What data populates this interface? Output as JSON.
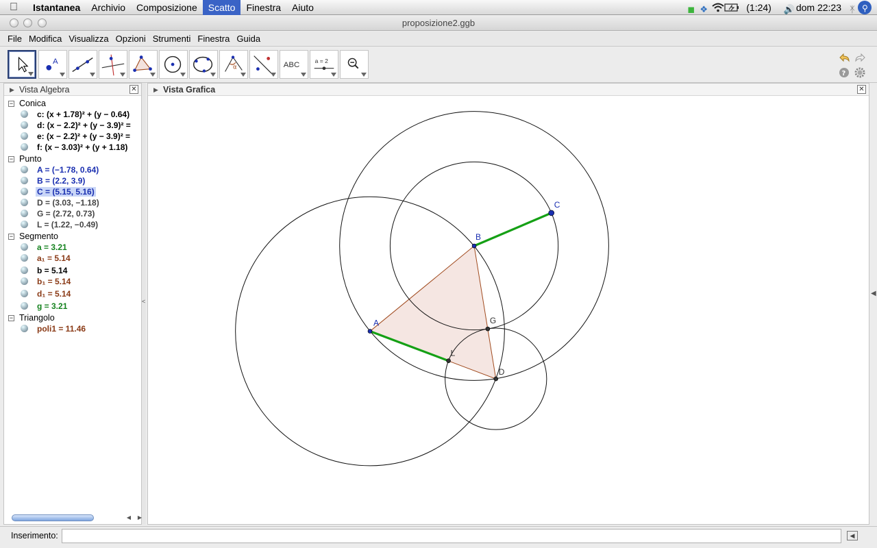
{
  "menubar": {
    "app_name": "Istantanea",
    "items": [
      "Archivio",
      "Composizione",
      "Scatto",
      "Finestra",
      "Aiuto"
    ],
    "active_item": "Scatto",
    "battery": "(1:24)",
    "clock": "dom 22:23"
  },
  "window": {
    "title": "proposizione2.ggb"
  },
  "app_menu": [
    "File",
    "Modifica",
    "Visualizza",
    "Opzioni",
    "Strumenti",
    "Finestra",
    "Guida"
  ],
  "toolbar": {
    "tools": [
      {
        "name": "move-tool",
        "selected": true
      },
      {
        "name": "point-tool"
      },
      {
        "name": "line-tool"
      },
      {
        "name": "perpendicular-tool"
      },
      {
        "name": "polygon-tool"
      },
      {
        "name": "circle-center-point-tool"
      },
      {
        "name": "conic-tool"
      },
      {
        "name": "angle-tool"
      },
      {
        "name": "reflect-tool"
      },
      {
        "name": "text-tool",
        "label": "ABC"
      },
      {
        "name": "slider-tool",
        "label": "a = 2"
      },
      {
        "name": "zoom-tool"
      }
    ]
  },
  "algebra": {
    "title": "Vista Algebra",
    "categories": [
      {
        "label": "Conica",
        "items": [
          {
            "text": "c: (x + 1.78)² + (y − 0.64)",
            "color": "#000000"
          },
          {
            "text": "d: (x − 2.2)² + (y − 3.9)² =",
            "color": "#000000"
          },
          {
            "text": "e: (x − 2.2)² + (y − 3.9)² =",
            "color": "#000000"
          },
          {
            "text": "f: (x − 3.03)² + (y + 1.18)",
            "color": "#000000"
          }
        ]
      },
      {
        "label": "Punto",
        "items": [
          {
            "text": "A = (−1.78, 0.64)",
            "color": "#1a2fb0"
          },
          {
            "text": "B = (2.2, 3.9)",
            "color": "#1a2fb0"
          },
          {
            "text": "C = (5.15, 5.16)",
            "color": "#1a2fb0",
            "selected": true
          },
          {
            "text": "D = (3.03, −1.18)",
            "color": "#444444"
          },
          {
            "text": "G = (2.72, 0.73)",
            "color": "#444444"
          },
          {
            "text": "L = (1.22, −0.49)",
            "color": "#444444"
          }
        ]
      },
      {
        "label": "Segmento",
        "items": [
          {
            "text": "a = 3.21",
            "color": "#14821e"
          },
          {
            "text": "a₁ = 5.14",
            "color": "#8a3a16"
          },
          {
            "text": "b = 5.14",
            "color": "#000000"
          },
          {
            "text": "b₁ = 5.14",
            "color": "#8a3a16"
          },
          {
            "text": "d₁ = 5.14",
            "color": "#8a3a16"
          },
          {
            "text": "g = 3.21",
            "color": "#14821e"
          }
        ]
      },
      {
        "label": "Triangolo",
        "items": [
          {
            "text": "poli1 = 11.46",
            "color": "#8a3a16"
          }
        ]
      }
    ]
  },
  "graphics": {
    "title": "Vista Grafica",
    "points": [
      {
        "name": "A",
        "x": -1.78,
        "y": 0.64,
        "color": "#1a2fb0"
      },
      {
        "name": "B",
        "x": 2.2,
        "y": 3.9,
        "color": "#1a2fb0"
      },
      {
        "name": "C",
        "x": 5.15,
        "y": 5.16,
        "color": "#1a2fb0"
      },
      {
        "name": "D",
        "x": 3.03,
        "y": -1.18,
        "color": "#333333"
      },
      {
        "name": "G",
        "x": 2.72,
        "y": 0.73,
        "color": "#333333"
      },
      {
        "name": "L",
        "x": 1.22,
        "y": -0.49,
        "color": "#333333"
      }
    ],
    "circles": [
      {
        "name": "c",
        "cx": -1.78,
        "cy": 0.64,
        "r": 5.14
      },
      {
        "name": "d",
        "cx": 2.2,
        "cy": 3.9,
        "r": 5.14
      },
      {
        "name": "e",
        "cx": 2.2,
        "cy": 3.9,
        "r": 3.21
      },
      {
        "name": "f",
        "cx": 3.03,
        "cy": -1.18,
        "r": 1.94
      }
    ],
    "segments": [
      {
        "from": "A",
        "to": "L",
        "color": "#15a015"
      },
      {
        "from": "B",
        "to": "C",
        "color": "#15a015"
      }
    ],
    "triangle": {
      "vertices": [
        "A",
        "B",
        "D"
      ],
      "stroke": "#a04a1e",
      "fill": "#f3e2dd"
    }
  },
  "input_bar": {
    "label": "Inserimento:",
    "value": ""
  }
}
